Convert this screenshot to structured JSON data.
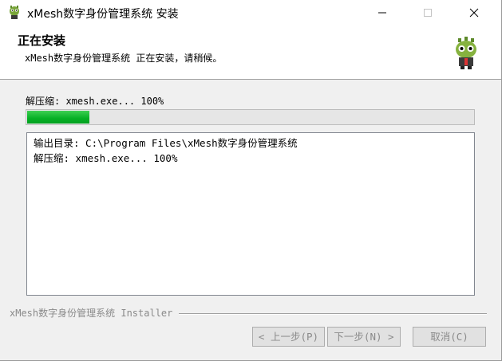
{
  "window": {
    "title": "xMesh数字身份管理系统 安装",
    "app_icon": "mascot-icon"
  },
  "header": {
    "title": "正在安装",
    "subtitle": "xMesh数字身份管理系统 正在安装，请稍候。"
  },
  "status": {
    "label": "解压缩: xmesh.exe... 100%",
    "progress_percent": 14,
    "progress_color": "#06b025"
  },
  "log": {
    "lines": [
      "输出目录: C:\\Program Files\\xMesh数字身份管理系统",
      "解压缩: xmesh.exe... 100%"
    ]
  },
  "branding": {
    "text": "xMesh数字身份管理系统 Installer"
  },
  "buttons": {
    "back": "< 上一步(P)",
    "next": "下一步(N) >",
    "cancel": "取消(C)"
  }
}
